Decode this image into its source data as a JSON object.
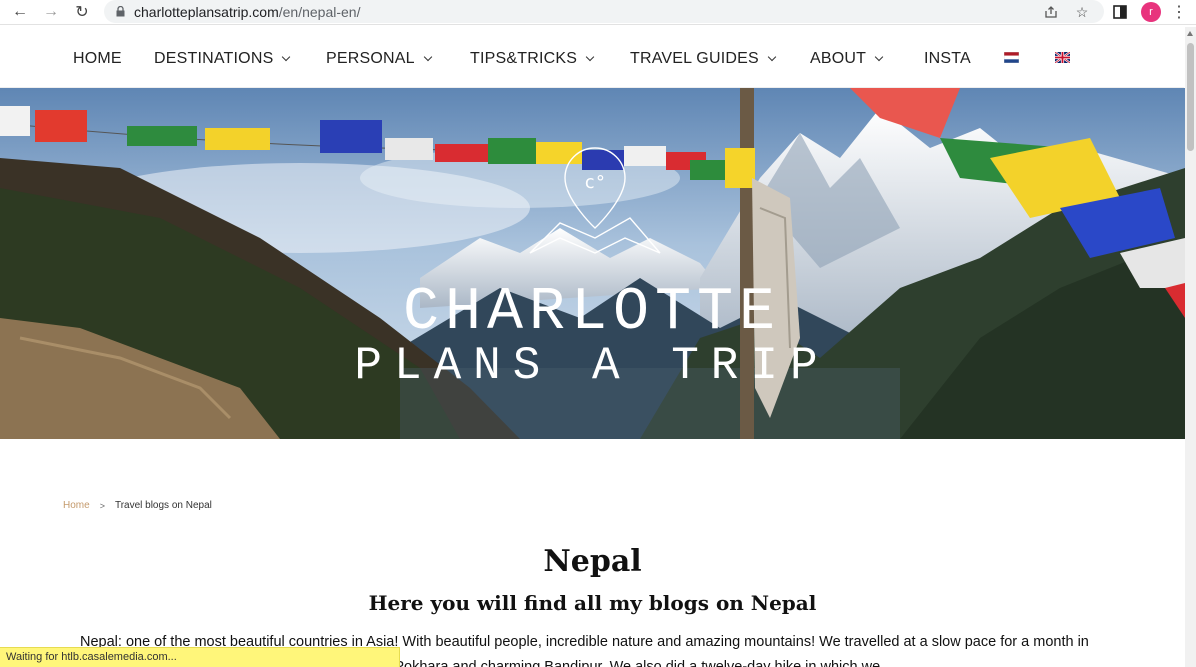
{
  "browser": {
    "url_domain": "charlotteplansatrip.com",
    "url_path": "/en/nepal-en/",
    "profile_initial": "r",
    "status_text": "Waiting for htlb.casalemedia.com..."
  },
  "nav": {
    "items": [
      {
        "label": "HOME"
      },
      {
        "label": "DESTINATIONS"
      },
      {
        "label": "PERSONAL"
      },
      {
        "label": "TIPS&TRICKS"
      },
      {
        "label": "TRAVEL GUIDES"
      },
      {
        "label": "ABOUT"
      },
      {
        "label": "INSTA"
      }
    ]
  },
  "hero": {
    "logo_line1": "CHARLOTTE",
    "logo_line2": "PLANS A TRIP",
    "logo_mark": "c°"
  },
  "breadcrumb": {
    "home": "Home",
    "separator": ">",
    "current": "Travel blogs on Nepal"
  },
  "page": {
    "title": "Nepal",
    "subtitle": "Here you will find all my blogs on Nepal",
    "intro": "Nepal: one of the most beautiful countries in Asia! With beautiful people, incredible nature and amazing mountains! We travelled at a slow pace for a month in which we visited Kathmandu, hip and happening Pokhara and charming Bandipur. We also did a twelve-day hike in which we"
  },
  "colors": {
    "accent": "#c49a6c",
    "status_bg": "#fff67a",
    "avatar": "#e8337d"
  }
}
